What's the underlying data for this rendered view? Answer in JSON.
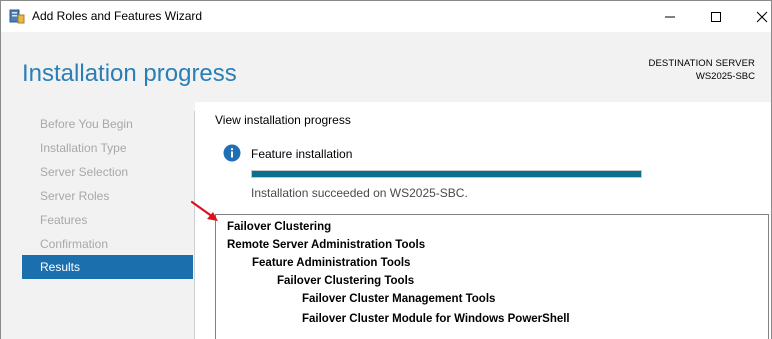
{
  "window": {
    "title": "Add Roles and Features Wizard"
  },
  "header": {
    "page_title": "Installation progress",
    "destination_label": "DESTINATION SERVER",
    "destination_server": "WS2025-SBC"
  },
  "nav": {
    "items": [
      {
        "label": "Before You Begin",
        "active": false
      },
      {
        "label": "Installation Type",
        "active": false
      },
      {
        "label": "Server Selection",
        "active": false
      },
      {
        "label": "Server Roles",
        "active": false
      },
      {
        "label": "Features",
        "active": false
      },
      {
        "label": "Confirmation",
        "active": false
      },
      {
        "label": "Results",
        "active": true
      }
    ]
  },
  "main": {
    "view_label": "View installation progress",
    "feature_label": "Feature installation",
    "progress_percent": 100,
    "status_text": "Installation succeeded on WS2025-SBC.",
    "results": [
      {
        "text": "Failover Clustering",
        "level": 0
      },
      {
        "text": "Remote Server Administration Tools",
        "level": 0
      },
      {
        "text": "Feature Administration Tools",
        "level": 1
      },
      {
        "text": "Failover Clustering Tools",
        "level": 2
      },
      {
        "text": "Failover Cluster Management Tools",
        "level": 3
      },
      {
        "text": "Failover Cluster Module for Windows PowerShell",
        "level": 3
      }
    ]
  },
  "colors": {
    "accent": "#1c6fad",
    "title_blue": "#2a7fb6",
    "progress": "#0e6e8e",
    "annotation_arrow": "#d9141e"
  },
  "icons": {
    "app": "server-manager-icon",
    "info": "info-icon",
    "annotation": "red-arrow-icon"
  }
}
